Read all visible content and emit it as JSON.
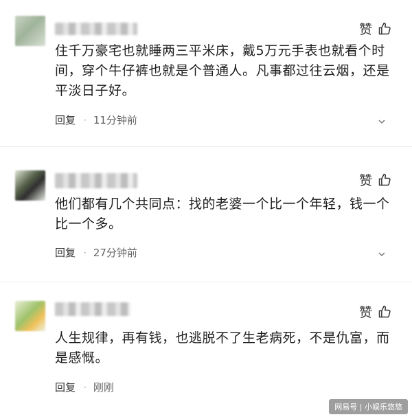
{
  "comments": [
    {
      "like_label": "赞",
      "text": "住千万豪宅也就睡两三平米床，戴5万元手表也就看个时间，穿个牛仔裤也就是个普通人。凡事都过往云烟，还是平淡日子好。",
      "reply_label": "回复",
      "dot": "·",
      "time": "11分钟前"
    },
    {
      "like_label": "赞",
      "text": "他们都有几个共同点：找的老婆一个比一个年轻，钱一个比一个多。",
      "reply_label": "回复",
      "dot": "·",
      "time": "27分钟前"
    },
    {
      "like_label": "赞",
      "text": "人生规律，再有钱，也逃脱不了生老病死，不是仇富，而是感慨。",
      "reply_label": "回复",
      "dot": "·",
      "time": "刚刚"
    }
  ],
  "watermark": "网易号 | 小娱乐悠悠",
  "icons": {
    "like": "thumbs-up-icon",
    "more": "chevron-down-icon"
  }
}
